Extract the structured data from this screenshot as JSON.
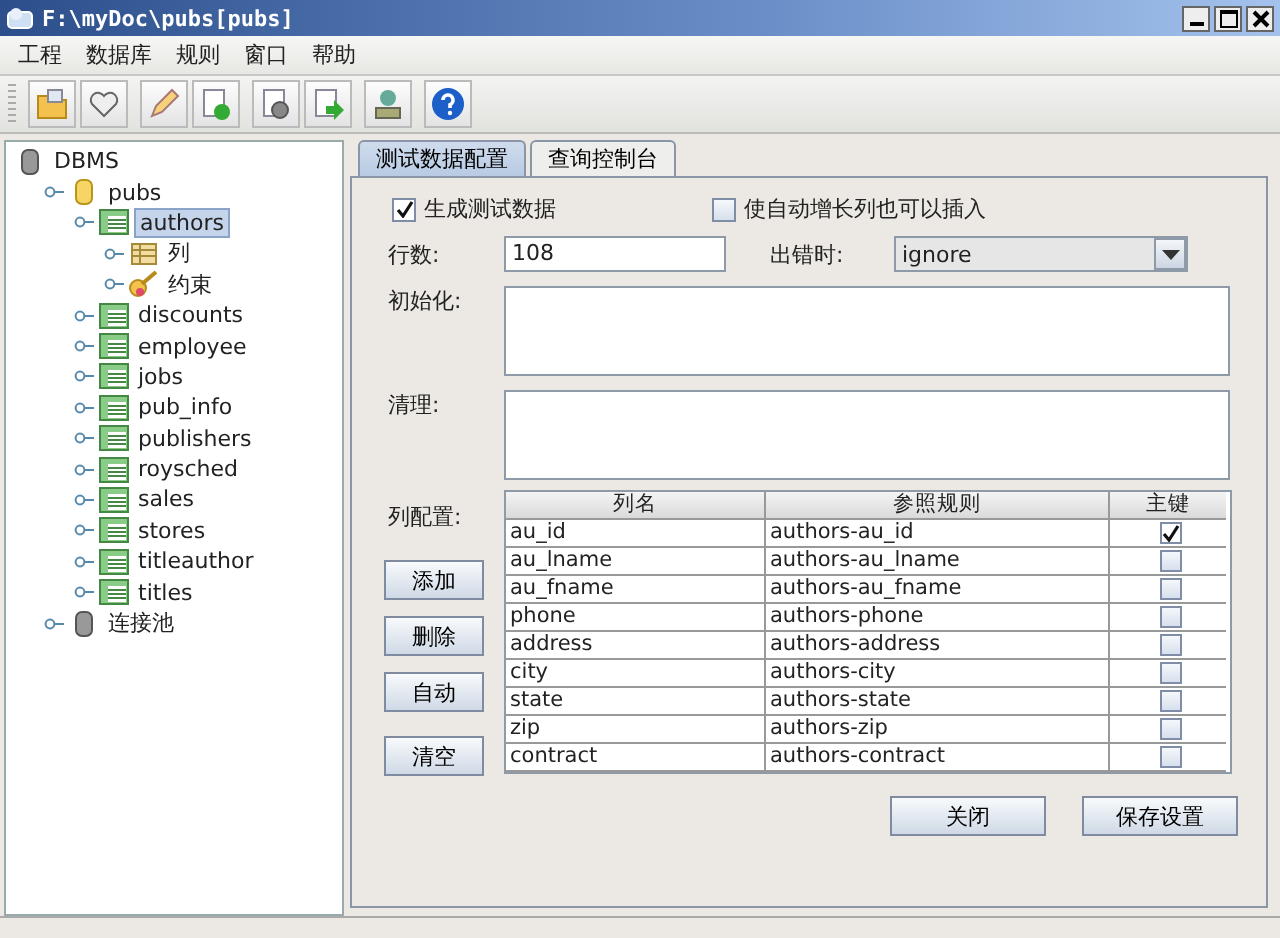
{
  "window": {
    "title": "F:\\myDoc\\pubs[pubs]"
  },
  "menu": [
    "工程",
    "数据库",
    "规则",
    "窗口",
    "帮助"
  ],
  "tree": [
    {
      "label": "DBMS",
      "kind": "server",
      "selected": false,
      "children": [
        {
          "label": "pubs",
          "kind": "database",
          "selected": false,
          "children": [
            {
              "label": "authors",
              "kind": "table",
              "selected": true,
              "children": [
                {
                  "label": "列",
                  "kind": "columns",
                  "selected": false
                },
                {
                  "label": "约束",
                  "kind": "key",
                  "selected": false
                }
              ]
            },
            {
              "label": "discounts",
              "kind": "table",
              "selected": false
            },
            {
              "label": "employee",
              "kind": "table",
              "selected": false
            },
            {
              "label": "jobs",
              "kind": "table",
              "selected": false
            },
            {
              "label": "pub_info",
              "kind": "table",
              "selected": false
            },
            {
              "label": "publishers",
              "kind": "table",
              "selected": false
            },
            {
              "label": "roysched",
              "kind": "table",
              "selected": false
            },
            {
              "label": "sales",
              "kind": "table",
              "selected": false
            },
            {
              "label": "stores",
              "kind": "table",
              "selected": false
            },
            {
              "label": "titleauthor",
              "kind": "table",
              "selected": false
            },
            {
              "label": "titles",
              "kind": "table",
              "selected": false
            }
          ]
        },
        {
          "label": "连接池",
          "kind": "pool",
          "selected": false
        }
      ]
    }
  ],
  "tabs": [
    {
      "label": "测试数据配置",
      "selected": true
    },
    {
      "label": "查询控制台",
      "selected": false
    }
  ],
  "form": {
    "generate": {
      "label": "生成测试数据",
      "checked": true
    },
    "auto_increment": {
      "label": "使自动增长列也可以插入",
      "checked": false
    },
    "rows_label": "行数:",
    "rows_value": "108",
    "on_error_label": "出错时:",
    "on_error_value": "ignore",
    "init_label": "初始化:",
    "cleanup_label": "清理:",
    "columns_label": "列配置:"
  },
  "side_buttons": [
    "添加",
    "删除",
    "自动",
    "清空"
  ],
  "table": {
    "columns": [
      "列名",
      "参照规则",
      "主键"
    ],
    "rows": [
      {
        "name": "au_id",
        "rule": "authors-au_id",
        "primary_key": true
      },
      {
        "name": "au_lname",
        "rule": "authors-au_lname",
        "primary_key": false
      },
      {
        "name": "au_fname",
        "rule": "authors-au_fname",
        "primary_key": false
      },
      {
        "name": "phone",
        "rule": "authors-phone",
        "primary_key": false
      },
      {
        "name": "address",
        "rule": "authors-address",
        "primary_key": false
      },
      {
        "name": "city",
        "rule": "authors-city",
        "primary_key": false
      },
      {
        "name": "state",
        "rule": "authors-state",
        "primary_key": false
      },
      {
        "name": "zip",
        "rule": "authors-zip",
        "primary_key": false
      },
      {
        "name": "contract",
        "rule": "authors-contract",
        "primary_key": false
      }
    ]
  },
  "buttons": [
    "关闭",
    "保存设置"
  ]
}
